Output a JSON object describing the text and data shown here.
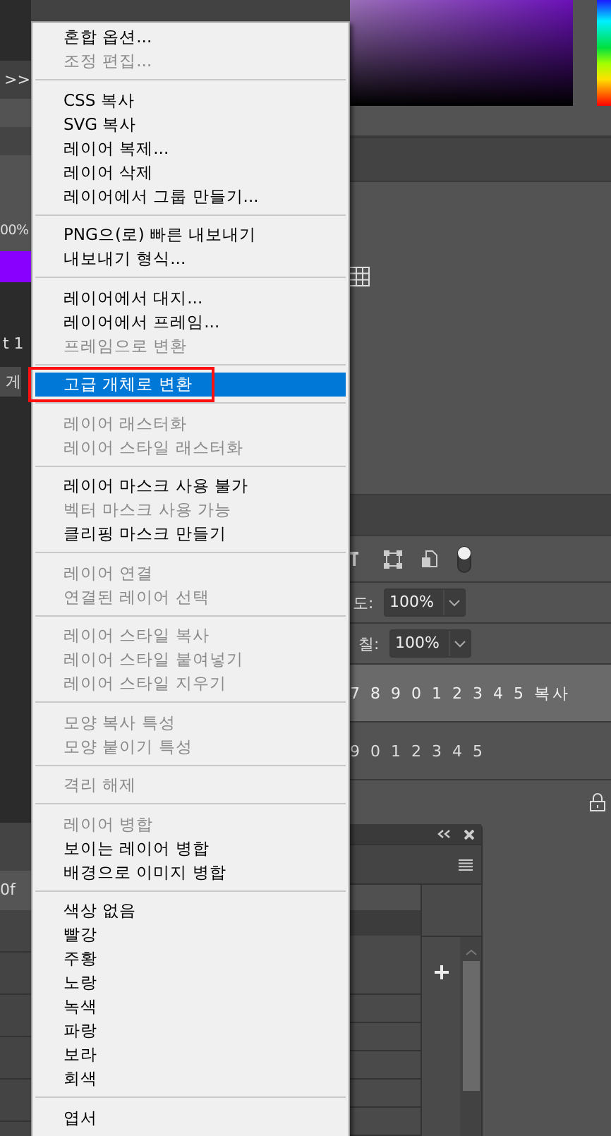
{
  "left_strip": {
    "overflow_label": ">>",
    "zoom_value": "00%",
    "font_label": "t 1",
    "button_label": "게",
    "field_value": "0f"
  },
  "properties": {
    "opacity_label": "도:",
    "opacity_value": "100%",
    "fill_label": "칠:",
    "fill_value": "100%"
  },
  "layers": [
    {
      "name": "7 8 9 0 1 2 3 4 5 복사",
      "selected": true
    },
    {
      "name": "9 0 1 2 3 4 5",
      "selected": false
    }
  ],
  "context_menu": {
    "sections": [
      {
        "items": [
          {
            "label": "혼합 옵션...",
            "disabled": false,
            "selected": false
          },
          {
            "label": "조정 편집...",
            "disabled": true,
            "selected": false
          }
        ]
      },
      {
        "items": [
          {
            "label": "CSS 복사",
            "disabled": false,
            "selected": false
          },
          {
            "label": "SVG 복사",
            "disabled": false,
            "selected": false
          },
          {
            "label": "레이어 복제...",
            "disabled": false,
            "selected": false
          },
          {
            "label": "레이어 삭제",
            "disabled": false,
            "selected": false
          },
          {
            "label": "레이어에서 그룹 만들기...",
            "disabled": false,
            "selected": false
          }
        ]
      },
      {
        "items": [
          {
            "label": "PNG으(로) 빠른 내보내기",
            "disabled": false,
            "selected": false
          },
          {
            "label": "내보내기 형식...",
            "disabled": false,
            "selected": false
          }
        ]
      },
      {
        "items": [
          {
            "label": "레이어에서 대지...",
            "disabled": false,
            "selected": false
          },
          {
            "label": "레이어에서 프레임...",
            "disabled": false,
            "selected": false
          },
          {
            "label": "프레임으로 변환",
            "disabled": true,
            "selected": false
          }
        ]
      },
      {
        "items": [
          {
            "label": "고급 개체로 변환",
            "disabled": false,
            "selected": true,
            "annotated": true
          }
        ]
      },
      {
        "items": [
          {
            "label": "레이어 래스터화",
            "disabled": true,
            "selected": false
          },
          {
            "label": "레이어 스타일 래스터화",
            "disabled": true,
            "selected": false
          }
        ]
      },
      {
        "items": [
          {
            "label": "레이어 마스크 사용 불가",
            "disabled": false,
            "selected": false
          },
          {
            "label": "벡터 마스크 사용 가능",
            "disabled": true,
            "selected": false
          },
          {
            "label": "클리핑 마스크 만들기",
            "disabled": false,
            "selected": false
          }
        ]
      },
      {
        "items": [
          {
            "label": "레이어 연결",
            "disabled": true,
            "selected": false
          },
          {
            "label": "연결된 레이어 선택",
            "disabled": true,
            "selected": false
          }
        ]
      },
      {
        "items": [
          {
            "label": "레이어 스타일 복사",
            "disabled": true,
            "selected": false
          },
          {
            "label": "레이어 스타일 붙여넣기",
            "disabled": true,
            "selected": false
          },
          {
            "label": "레이어 스타일 지우기",
            "disabled": true,
            "selected": false
          }
        ]
      },
      {
        "items": [
          {
            "label": "모양 복사 특성",
            "disabled": true,
            "selected": false
          },
          {
            "label": "모양 붙이기 특성",
            "disabled": true,
            "selected": false
          }
        ]
      },
      {
        "items": [
          {
            "label": "격리 해제",
            "disabled": true,
            "selected": false
          }
        ]
      },
      {
        "items": [
          {
            "label": "레이어 병합",
            "disabled": true,
            "selected": false
          },
          {
            "label": "보이는 레이어 병합",
            "disabled": false,
            "selected": false
          },
          {
            "label": "배경으로 이미지 병합",
            "disabled": false,
            "selected": false
          }
        ]
      },
      {
        "items": [
          {
            "label": "색상 없음",
            "disabled": false,
            "selected": false
          },
          {
            "label": "빨강",
            "disabled": false,
            "selected": false
          },
          {
            "label": "주황",
            "disabled": false,
            "selected": false
          },
          {
            "label": "노랑",
            "disabled": false,
            "selected": false
          },
          {
            "label": "녹색",
            "disabled": false,
            "selected": false
          },
          {
            "label": "파랑",
            "disabled": false,
            "selected": false
          },
          {
            "label": "보라",
            "disabled": false,
            "selected": false
          },
          {
            "label": "회색",
            "disabled": false,
            "selected": false
          }
        ]
      },
      {
        "items": [
          {
            "label": "엽서",
            "disabled": false,
            "selected": false
          }
        ]
      }
    ]
  }
}
